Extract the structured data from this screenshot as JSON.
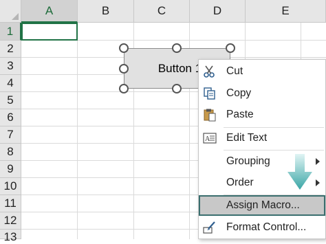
{
  "columns": [
    {
      "label": "A",
      "active": true
    },
    {
      "label": "B",
      "active": false
    },
    {
      "label": "C",
      "active": false
    },
    {
      "label": "D",
      "active": false
    },
    {
      "label": "E",
      "active": false
    }
  ],
  "rows": [
    {
      "label": "1",
      "active": true
    },
    {
      "label": "2",
      "active": false
    },
    {
      "label": "3",
      "active": false
    },
    {
      "label": "4",
      "active": false
    },
    {
      "label": "5",
      "active": false
    },
    {
      "label": "6",
      "active": false
    },
    {
      "label": "7",
      "active": false
    },
    {
      "label": "8",
      "active": false
    },
    {
      "label": "9",
      "active": false
    },
    {
      "label": "10",
      "active": false
    },
    {
      "label": "11",
      "active": false
    },
    {
      "label": "12",
      "active": false
    },
    {
      "label": "13",
      "active": false
    }
  ],
  "form_button": {
    "label": "Button 1"
  },
  "context_menu": {
    "items": [
      {
        "label": "Cut",
        "icon": "scissors-icon"
      },
      {
        "label": "Copy",
        "icon": "copy-icon"
      },
      {
        "label": "Paste",
        "icon": "clipboard-icon"
      },
      {
        "label": "Edit Text",
        "icon": "edit-text-icon"
      },
      {
        "label": "Grouping",
        "icon": "",
        "has_submenu": true
      },
      {
        "label": "Order",
        "icon": "",
        "has_submenu": true
      },
      {
        "label": "Assign Macro...",
        "icon": "",
        "highlighted": true
      },
      {
        "label": "Format Control...",
        "icon": "format-control-icon"
      }
    ]
  },
  "colors": {
    "accent_green": "#217346",
    "highlight_outline": "#3a6e6e",
    "arrow_teal": "#3aa6a6"
  }
}
